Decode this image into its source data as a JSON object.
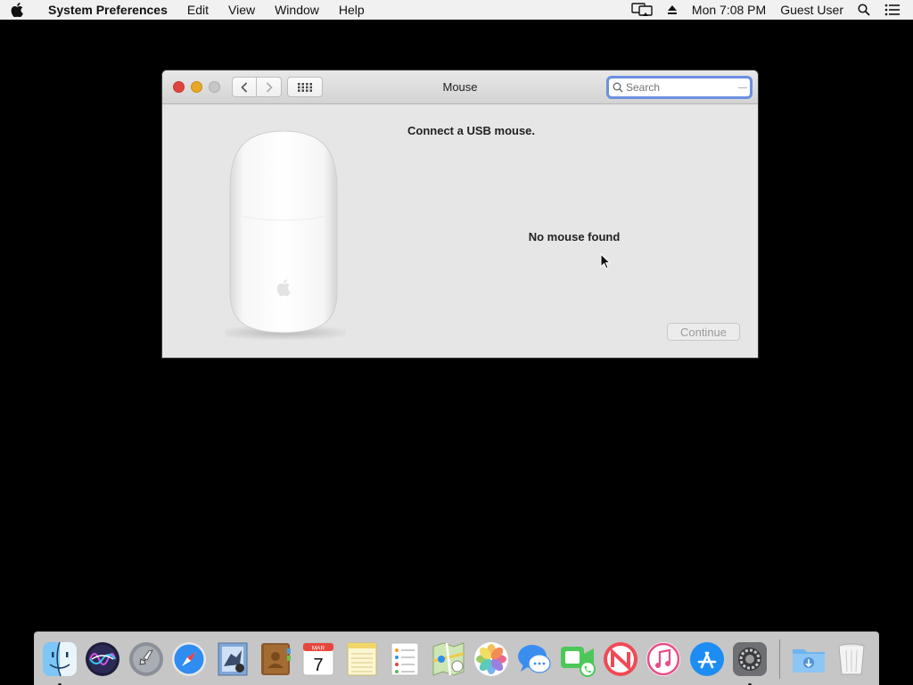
{
  "menubar": {
    "app_name": "System Preferences",
    "menus": [
      "Edit",
      "View",
      "Window",
      "Help"
    ],
    "clock": "Mon 7:08 PM",
    "user": "Guest User"
  },
  "window": {
    "title": "Mouse",
    "search_placeholder": "Search",
    "heading": "Connect a USB mouse.",
    "status": "No mouse found",
    "continue_label": "Continue"
  },
  "dock": {
    "items": [
      "Finder",
      "Siri",
      "Launchpad",
      "Safari",
      "Mail",
      "Contacts",
      "Calendar",
      "Notes",
      "Reminders",
      "Maps",
      "Photos",
      "Messages",
      "FaceTime",
      "News",
      "iTunes",
      "App Store",
      "System Preferences",
      "Downloads",
      "Trash"
    ],
    "calendar_month": "MAR",
    "calendar_day": "7"
  }
}
